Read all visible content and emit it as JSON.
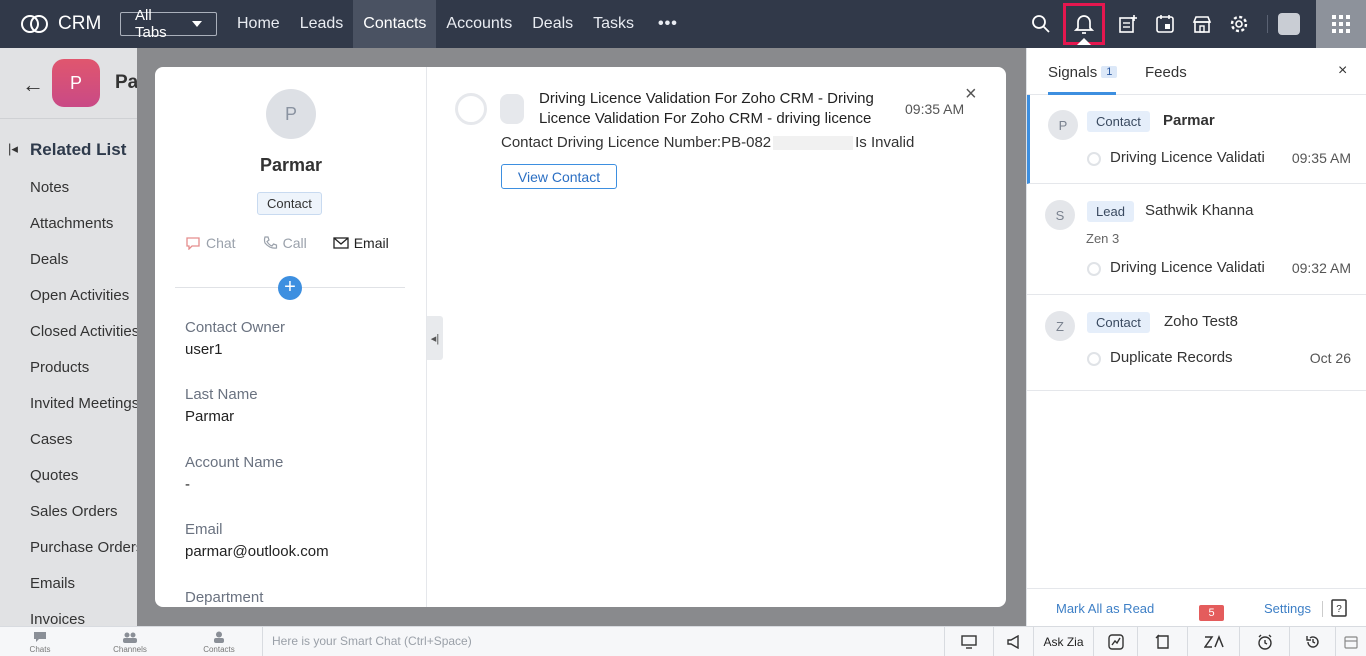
{
  "app": {
    "name": "CRM"
  },
  "nav": {
    "all_tabs": "All Tabs",
    "links": [
      "Home",
      "Leads",
      "Contacts",
      "Accounts",
      "Deals",
      "Tasks"
    ],
    "active": "Contacts",
    "more": "•••"
  },
  "topicons": [
    "search-icon",
    "bell-icon",
    "add-note-icon",
    "calendar-icon",
    "marketplace-icon",
    "gear-icon",
    "avatar",
    "apps-grid-icon"
  ],
  "record": {
    "avatar_letter": "P",
    "title": "Pa",
    "related_list_title": "Related List",
    "related_items": [
      "Notes",
      "Attachments",
      "Deals",
      "Open Activities",
      "Closed Activities",
      "Products",
      "Invited Meetings",
      "Cases",
      "Quotes",
      "Sales Orders",
      "Purchase Orders",
      "Emails",
      "Invoices"
    ]
  },
  "preview": {
    "avatar_letter": "P",
    "name": "Parmar",
    "badge": "Contact",
    "actions": {
      "chat": "Chat",
      "call": "Call",
      "email": "Email"
    },
    "plus": "+",
    "fields": [
      {
        "label": "Contact Owner",
        "value": "user1"
      },
      {
        "label": "Last Name",
        "value": "Parmar"
      },
      {
        "label": "Account Name",
        "value": "-"
      },
      {
        "label": "Email",
        "value": "parmar@outlook.com"
      },
      {
        "label": "Department",
        "value": ""
      }
    ],
    "notification": {
      "title": "Driving Licence Validation For Zoho CRM - Driving Licence Validation For Zoho CRM - driving licence",
      "time": "09:35 AM",
      "body_prefix": "Contact Driving Licence Number:PB-082",
      "body_suffix": "Is Invalid",
      "button": "View Contact",
      "close": "×"
    }
  },
  "signals_panel": {
    "tabs": {
      "signals": "Signals",
      "signals_count": "1",
      "feeds": "Feeds"
    },
    "close": "×",
    "items": [
      {
        "avatar": "P",
        "badge": "Contact",
        "name": "Parmar",
        "sub": "",
        "message": "Driving Licence Validation For Zoho CRM",
        "time": "09:35 AM"
      },
      {
        "avatar": "S",
        "badge": "Lead",
        "name": "Sathwik Khanna",
        "sub": "Zen 3",
        "message": "Driving Licence Validation For Zoho CRM",
        "time": "09:32 AM"
      },
      {
        "avatar": "Z",
        "badge": "Contact",
        "name": "Zoho Test8",
        "sub": "",
        "message": "Duplicate Records",
        "time": "Oct 26"
      }
    ],
    "footer": {
      "mark_all": "Mark All as Read",
      "settings": "Settings"
    }
  },
  "bottombar": {
    "chats": "Chats",
    "channels": "Channels",
    "contacts": "Contacts",
    "smartchat_placeholder": "Here is your Smart Chat (Ctrl+Space)",
    "ask_zia": "Ask Zia",
    "zia_badge": "5"
  },
  "colors": {
    "topbar": "#313949",
    "accent": "#3d8fe0",
    "highlight_box": "#e5174f"
  }
}
